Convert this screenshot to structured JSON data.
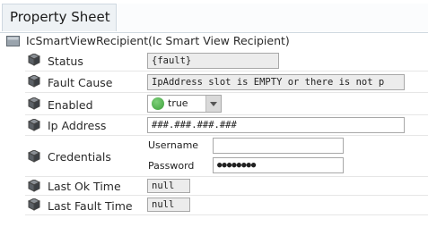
{
  "tab": {
    "title": "Property Sheet"
  },
  "root": {
    "name": "IcSmartViewRecipient",
    "type": "(Ic Smart View Recipient)"
  },
  "props": {
    "status": {
      "label": "Status",
      "value": "{fault}"
    },
    "fault_cause": {
      "label": "Fault Cause",
      "value": "IpAddress slot is EMPTY or there is not p"
    },
    "enabled": {
      "label": "Enabled",
      "value": "true"
    },
    "ip_address": {
      "label": "Ip Address",
      "value": "###.###.###.###"
    },
    "credentials": {
      "label": "Credentials",
      "username_label": "Username",
      "username_value": "",
      "password_label": "Password",
      "password_value": "●●●●●●●●"
    },
    "last_ok_time": {
      "label": "Last Ok Time",
      "value": "null"
    },
    "last_fault_time": {
      "label": "Last Fault Time",
      "value": "null"
    }
  },
  "icons": {
    "root": "component-icon",
    "property": "cube-icon",
    "enabled_status": "green-dot-icon",
    "dropdown": "chevron-down-icon"
  }
}
